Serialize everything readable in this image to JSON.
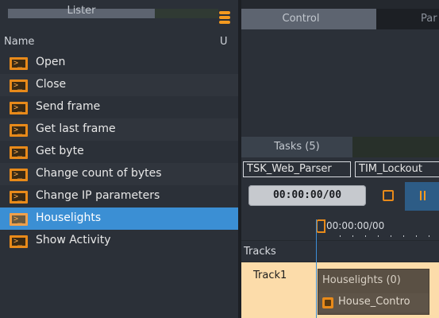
{
  "lister": {
    "title": "Lister",
    "columns": {
      "name": "Name",
      "u": "U"
    },
    "items": [
      {
        "label": "Open",
        "icon": "script-icon",
        "selected": false
      },
      {
        "label": "Close",
        "icon": "script-icon",
        "selected": false
      },
      {
        "label": "Send frame",
        "icon": "script-icon",
        "selected": false
      },
      {
        "label": "Get last frame",
        "icon": "script-icon",
        "selected": false
      },
      {
        "label": "Get byte",
        "icon": "script-icon",
        "selected": false
      },
      {
        "label": "Change count of bytes",
        "icon": "script-icon",
        "selected": false
      },
      {
        "label": "Change IP parameters",
        "icon": "script-icon",
        "selected": false
      },
      {
        "label": "Houselights",
        "icon": "script-icon",
        "selected": true
      },
      {
        "label": "Show Activity",
        "icon": "script-icon",
        "selected": false
      }
    ]
  },
  "control": {
    "tab_label": "Control",
    "next_tab_label": "Par"
  },
  "tasks": {
    "tab_label": "Tasks (5)",
    "chips": [
      "TSK_Web_Parser",
      "TIM_Lockout"
    ],
    "time": "00:00:00/00",
    "ruler_time": "00:00:00/00",
    "tracks_label": "Tracks",
    "track1_label": "Track1",
    "clip_title": "Houselights (0)",
    "clip_item": "House_Contro"
  },
  "colors": {
    "accent_orange": "#e88a1a",
    "selection_blue": "#3b8fd4",
    "track_bg": "#fcdcaa"
  }
}
